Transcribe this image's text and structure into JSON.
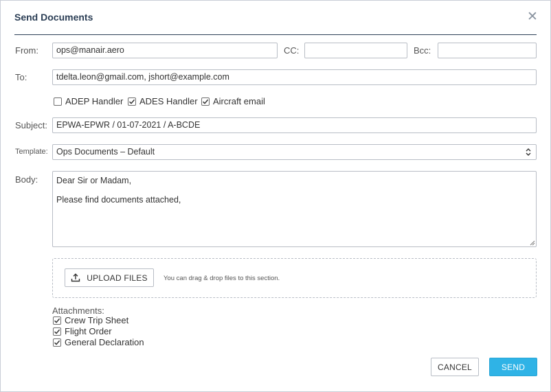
{
  "dialog": {
    "title": "Send Documents"
  },
  "fields": {
    "from": {
      "label": "From:",
      "value": "ops@manair.aero"
    },
    "cc": {
      "label": "CC:",
      "value": ""
    },
    "bcc": {
      "label": "Bcc:",
      "value": ""
    },
    "to": {
      "label": "To:",
      "value": "tdelta.leon@gmail.com, jshort@example.com"
    },
    "subject": {
      "label": "Subject:",
      "value": "EPWA-EPWR / 01-07-2021 / A-BCDE"
    },
    "template": {
      "label": "Template:",
      "value": "Ops Documents – Default"
    },
    "body": {
      "label": "Body:",
      "lines": [
        "Dear Sir or Madam,",
        "Please find documents attached,"
      ]
    }
  },
  "recipient_options": [
    {
      "label": "ADEP Handler",
      "checked": false
    },
    {
      "label": "ADES Handler",
      "checked": true
    },
    {
      "label": "Aircraft email",
      "checked": true
    }
  ],
  "upload": {
    "button_label": "UPLOAD FILES",
    "hint": "You can drag & drop files to this section."
  },
  "attachments": {
    "label": "Attachments:",
    "items": [
      {
        "label": "Crew Trip Sheet",
        "checked": true
      },
      {
        "label": "Flight Order",
        "checked": true
      },
      {
        "label": "General Declaration",
        "checked": true
      }
    ]
  },
  "actions": {
    "cancel_label": "CANCEL",
    "send_label": "SEND"
  },
  "icons": {
    "close": "close-icon",
    "upload": "upload-icon",
    "select_arrows": "chevron-up-down-icon"
  },
  "colors": {
    "title": "#2b3e55",
    "accent": "#2fb3e6",
    "border": "#b8bdc5"
  }
}
